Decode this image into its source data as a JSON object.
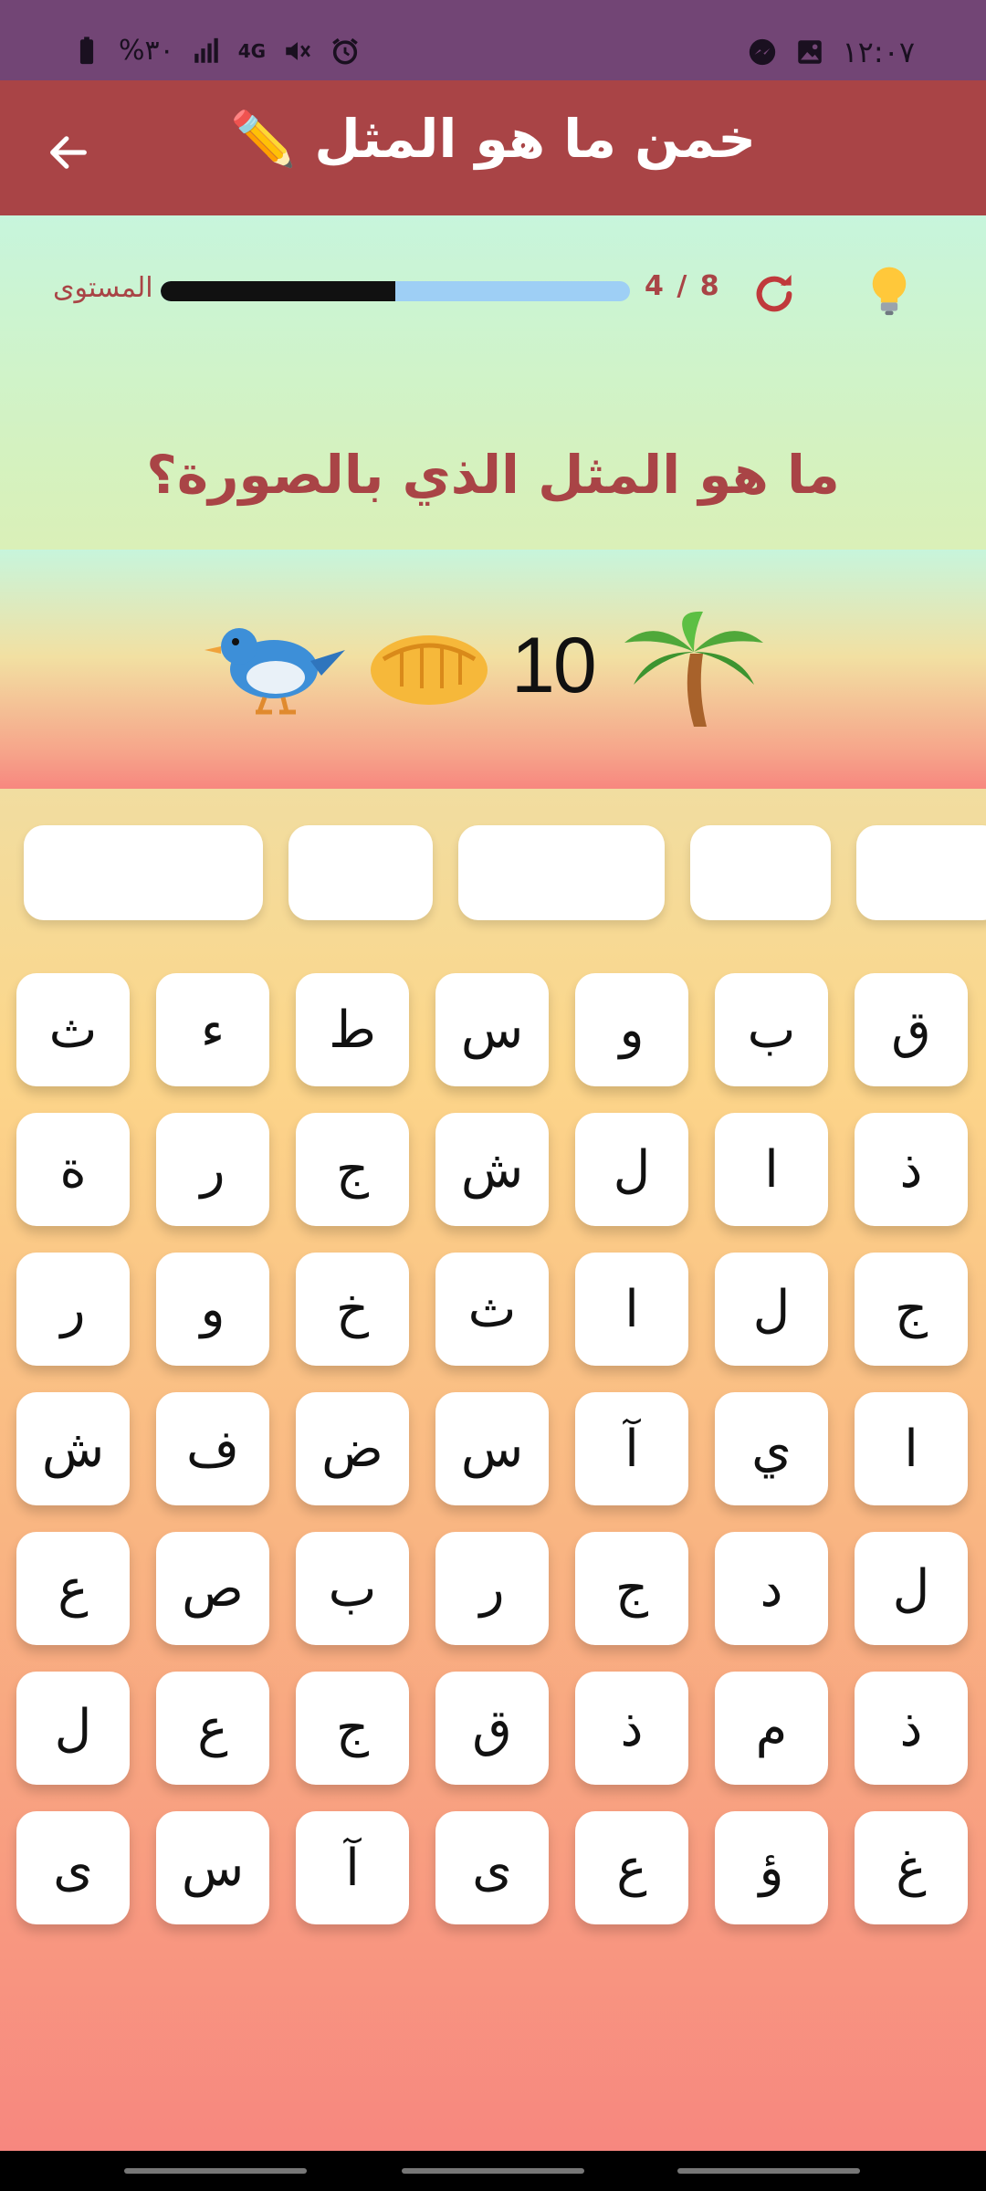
{
  "status_bar": {
    "time": "١٢:٠٧",
    "battery": "%٣٠",
    "network": "4G",
    "icons": [
      "messenger-icon",
      "gallery-icon",
      "alarm-icon",
      "mute-icon",
      "network-4g-icon",
      "signal-icon",
      "battery-icon"
    ]
  },
  "app_bar": {
    "title": "خمن ما هو المثل ✏️",
    "back_icon": "arrow-left-icon"
  },
  "header": {
    "level_label": "المستوى",
    "level_count": "4 / 8",
    "progress": 0.5,
    "refresh_icon": "refresh-icon",
    "hint_icon": "lightbulb-icon"
  },
  "question": "ما هو المثل الذي بالصورة؟",
  "picture": {
    "number": "10",
    "emojis": [
      "palm-tree-icon",
      "fist-icon",
      "bird-icon"
    ]
  },
  "answer_slots": 5,
  "keyboard": {
    "rows": [
      [
        "ق",
        "ب",
        "و",
        "س",
        "ط",
        "ء",
        "ث"
      ],
      [
        "ذ",
        "ا",
        "ل",
        "ش",
        "ج",
        "ر",
        "ة"
      ],
      [
        "ج",
        "ل",
        "ا",
        "ث",
        "خ",
        "و",
        "ر"
      ],
      [
        "ا",
        "ي",
        "آ",
        "س",
        "ض",
        "ف",
        "ش"
      ],
      [
        "ل",
        "د",
        "ج",
        "ر",
        "ب",
        "ص",
        "ع"
      ],
      [
        "ذ",
        "م",
        "ذ",
        "ق",
        "ج",
        "ع",
        "ل"
      ],
      [
        "غ",
        "ؤ",
        "ع",
        "ى",
        "آ",
        "س",
        "ى"
      ]
    ]
  },
  "colors": {
    "status_bar": "#724575",
    "app_bar": "#a94446",
    "accent_text": "#a94446",
    "progress_fill": "#111111",
    "progress_track": "#9ecff5"
  }
}
